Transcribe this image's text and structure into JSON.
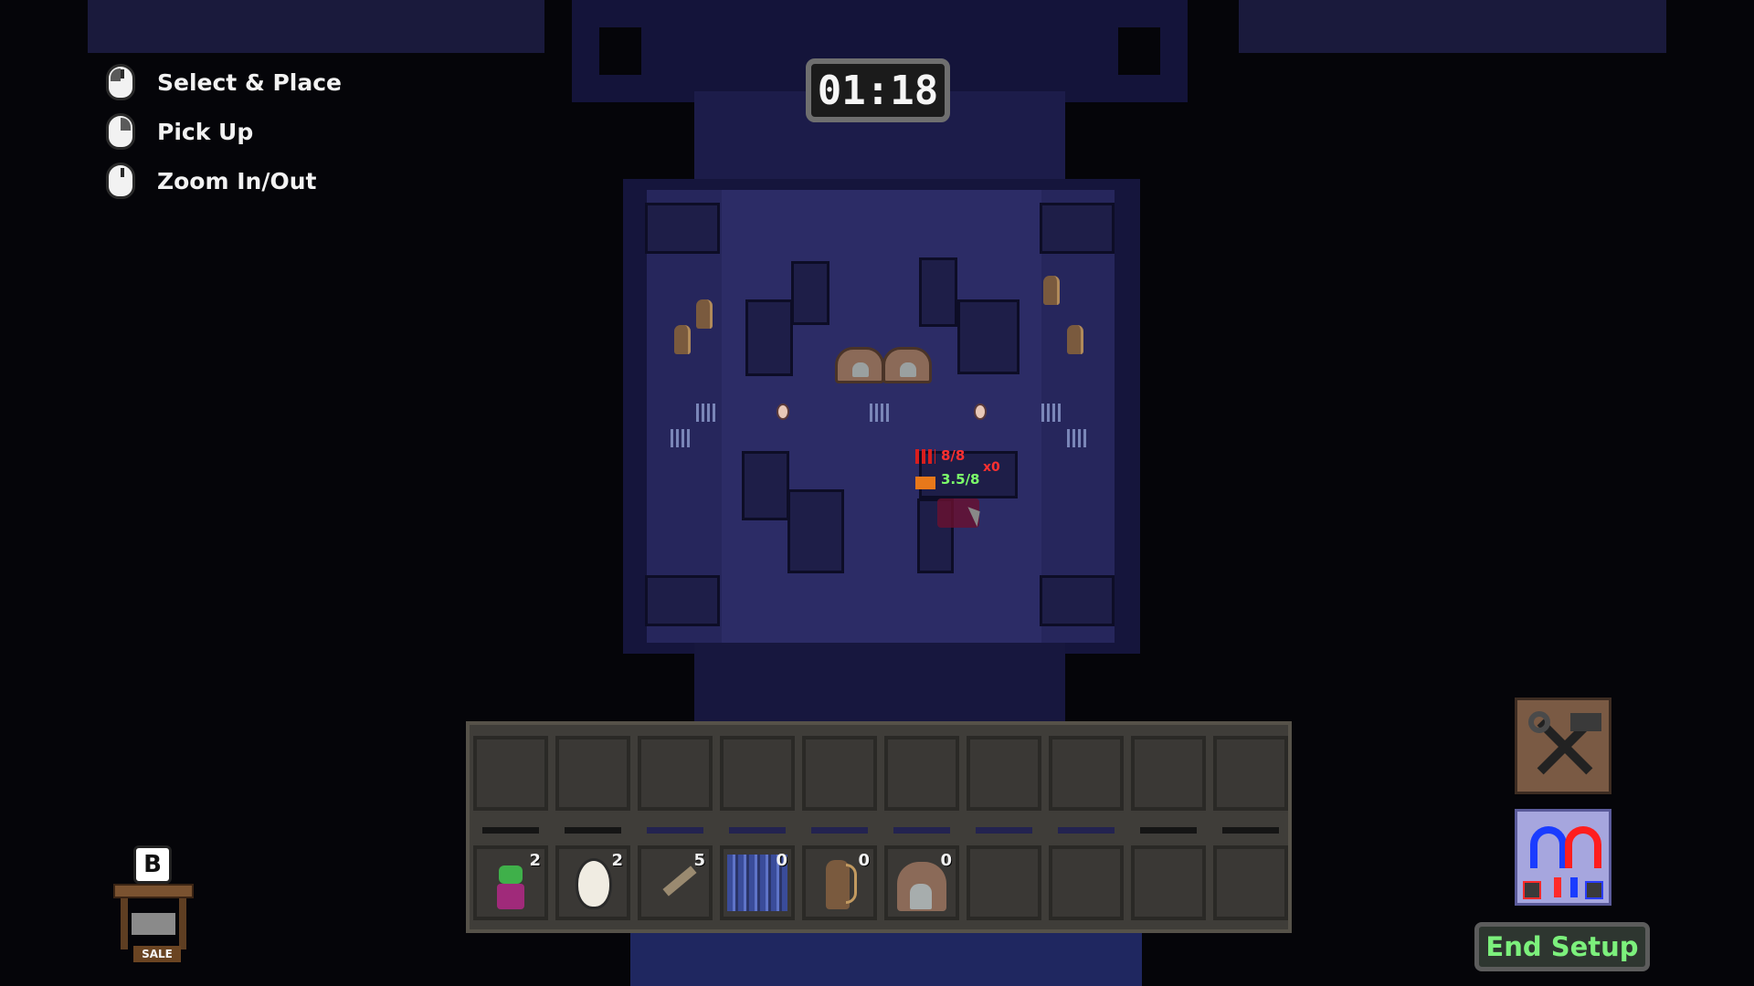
{
  "controls": [
    {
      "label": "Select & Place",
      "icon": "mouse-left-click-icon"
    },
    {
      "label": "Pick Up",
      "icon": "mouse-right-click-icon"
    },
    {
      "label": "Zoom In/Out",
      "icon": "mouse-scroll-icon"
    }
  ],
  "timer": "01:18",
  "placement_stats": {
    "damage": "8/8",
    "defense": "3.5/8",
    "multiplier": "x0"
  },
  "inventory": {
    "items": [
      {
        "name": "goblin-mage",
        "count": "2"
      },
      {
        "name": "egg-spawner",
        "count": "2"
      },
      {
        "name": "sword-trap",
        "count": "5"
      },
      {
        "name": "spike-trap",
        "count": "0"
      },
      {
        "name": "archer",
        "count": "0"
      },
      {
        "name": "grave-spawner",
        "count": "0"
      }
    ]
  },
  "shop": {
    "hotkey": "B",
    "sign": "SALE"
  },
  "tools": {
    "build_icon": "hammer-wrench-icon",
    "magnet_icon": "magnet-icon"
  },
  "end_setup_label": "End Setup",
  "colors": {
    "room_floor": "#26265c",
    "end_setup_text": "#7cf07c",
    "stat_red": "#ff3030",
    "stat_green": "#7cff6a"
  }
}
